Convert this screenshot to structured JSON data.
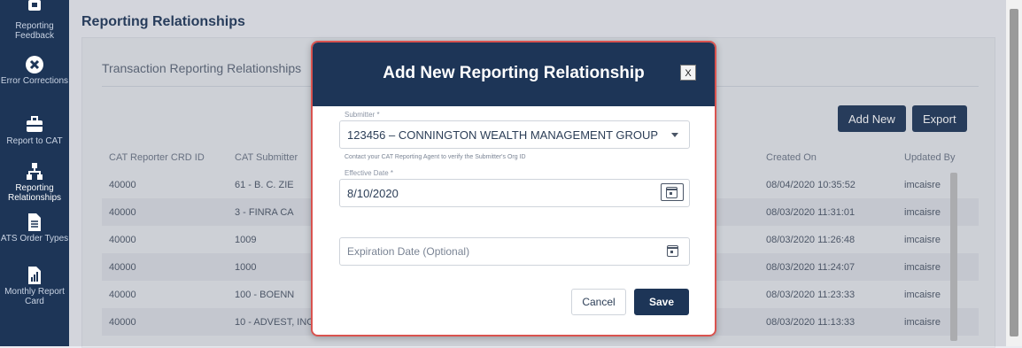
{
  "sidebar": {
    "items": [
      {
        "label": "Reporting Feedback",
        "icon": "report-feedback-icon"
      },
      {
        "label": "Error Corrections",
        "icon": "error-x-icon"
      },
      {
        "label": "Report to CAT",
        "icon": "briefcase-icon"
      },
      {
        "label": "Reporting Relationships",
        "icon": "relationships-icon",
        "active": true
      },
      {
        "label": "ATS Order Types",
        "icon": "document-icon"
      },
      {
        "label": "Monthly Report Card",
        "icon": "bar-chart-icon"
      }
    ]
  },
  "page": {
    "title": "Reporting Relationships",
    "card_title": "Transaction Reporting Relationships"
  },
  "toolbar": {
    "add_new_label": "Add New",
    "export_label": "Export"
  },
  "table": {
    "headers": [
      "CAT Reporter CRD ID",
      "CAT Submitter",
      "",
      "",
      "",
      "Created On",
      "Updated By"
    ],
    "rows": [
      {
        "crd": "40000",
        "submitter": "61 - B. C. ZIE",
        "created": "08/04/2020 10:35:52",
        "updated_by": "imcaisre"
      },
      {
        "crd": "40000",
        "submitter": "3 - FINRA CA",
        "created": "08/03/2020 11:31:01",
        "updated_by": "imcaisre"
      },
      {
        "crd": "40000",
        "submitter": "1009",
        "created": "08/03/2020 11:26:48",
        "updated_by": "imcaisre"
      },
      {
        "crd": "40000",
        "submitter": "1000",
        "created": "08/03/2020 11:24:07",
        "updated_by": "imcaisre"
      },
      {
        "crd": "40000",
        "submitter": "100 - BOENN",
        "created": "08/03/2020 11:23:33",
        "updated_by": "imcaisre"
      },
      {
        "crd": "40000",
        "submitter": "10 - ADVEST, INC.",
        "created": "08/03/2020 11:13:33",
        "updated_by": "imcaisre"
      }
    ]
  },
  "modal": {
    "title": "Add New Reporting Relationship",
    "close_label": "X",
    "submitter_label": "Submitter *",
    "submitter_value": "123456 – CONNINGTON WEALTH MANAGEMENT GROUP",
    "helper_text": "Contact your CAT Reporting Agent to verify the Submitter's Org ID",
    "effective_label": "Effective Date *",
    "effective_value": "8/10/2020",
    "expiration_placeholder": "Expiration Date (Optional)",
    "cancel_label": "Cancel",
    "save_label": "Save"
  },
  "colors": {
    "sidebar_bg": "#1d3557",
    "primary": "#1d3557",
    "modal_border": "#d9534f"
  }
}
